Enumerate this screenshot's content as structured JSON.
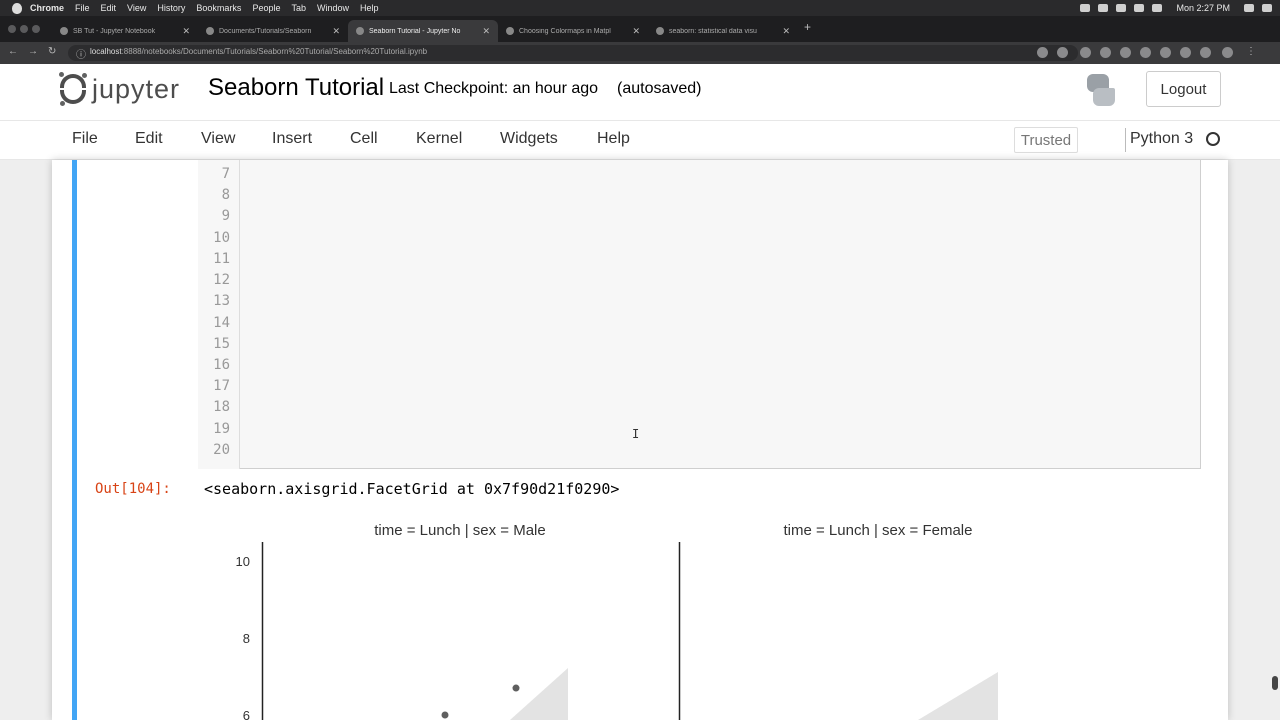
{
  "mac_menubar": {
    "app": "Chrome",
    "items": [
      "File",
      "Edit",
      "View",
      "History",
      "Bookmarks",
      "People",
      "Tab",
      "Window",
      "Help"
    ],
    "clock": "Mon 2:27 PM"
  },
  "tabs": [
    {
      "label": "SB Tut - Jupyter Notebook",
      "active": false
    },
    {
      "label": "Documents/Tutorials/Seaborn",
      "active": false
    },
    {
      "label": "Seaborn Tutorial - Jupyter No",
      "active": true
    },
    {
      "label": "Choosing Colormaps in Matpl",
      "active": false
    },
    {
      "label": "seaborn: statistical data visu",
      "active": false
    }
  ],
  "address": {
    "host": "localhost",
    "path": ":8888/notebooks/Documents/Tutorials/Seaborn%20Tutorial/Seaborn%20Tutorial.ipynb"
  },
  "header": {
    "brand": "jupyter",
    "notebook_title": "Seaborn Tutorial",
    "checkpoint": "Last Checkpoint: an hour ago",
    "autosaved": "(autosaved)",
    "logout": "Logout"
  },
  "menu": {
    "items": [
      "File",
      "Edit",
      "View",
      "Insert",
      "Cell",
      "Kernel",
      "Widgets",
      "Help"
    ],
    "trusted": "Trusted",
    "kernel": "Python 3"
  },
  "editor": {
    "line_numbers": [
      "7",
      "8",
      "9",
      "10",
      "11",
      "12",
      "13",
      "14",
      "15",
      "16",
      "17",
      "18",
      "19",
      "20"
    ]
  },
  "output": {
    "prompt": "Out[104]:",
    "text": "<seaborn.axisgrid.FacetGrid at 0x7f90d21f0290>"
  },
  "chart_data": {
    "type": "scatter",
    "panels": [
      {
        "title": "time = Lunch | sex = Male",
        "points": [
          {
            "x": null,
            "y": 6.7
          },
          {
            "x": null,
            "y": 6.0
          }
        ]
      },
      {
        "title": "time = Lunch | sex = Female",
        "points": []
      }
    ],
    "yticks": [
      "10",
      "8",
      "6"
    ],
    "ylim": [
      5.9,
      10.5
    ],
    "colors": {
      "points": "#5f5f5f",
      "band": "#e3e3e3"
    }
  }
}
